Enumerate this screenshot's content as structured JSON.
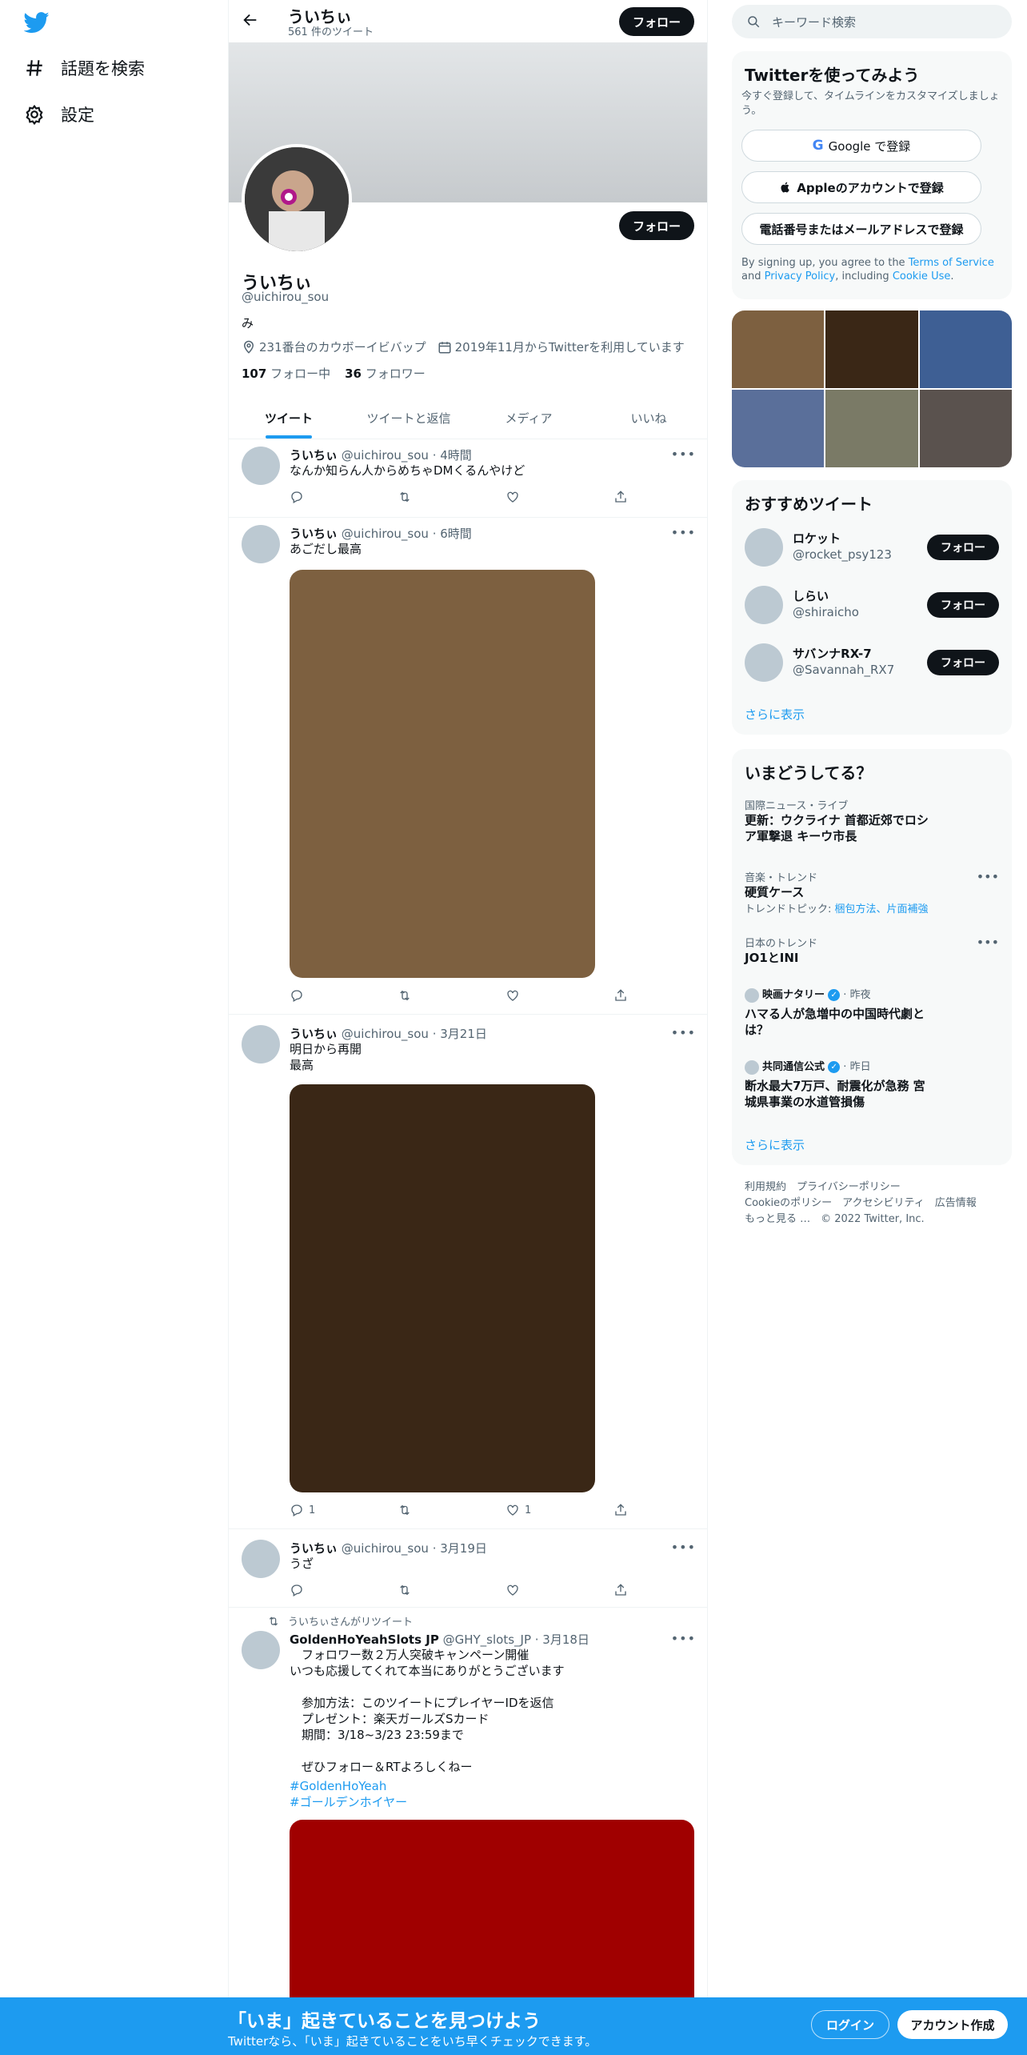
{
  "nav": {
    "items": [
      {
        "label": "話題を検索",
        "icon": "hashtag-icon"
      },
      {
        "label": "設定",
        "icon": "gear-icon"
      }
    ]
  },
  "header": {
    "name": "ういちぃ",
    "tweet_count": "561 件のツイート",
    "follow_label": "フォロー"
  },
  "profile": {
    "name": "ういちぃ",
    "handle": "@uichirou_sou",
    "bio": "み",
    "location": "231番台のカウボーイビバップ",
    "joined": "2019年11月からTwitterを利用しています",
    "following_count": "107",
    "following_label": "フォロー中",
    "followers_count": "36",
    "followers_label": "フォロワー",
    "follow_label": "フォロー"
  },
  "tabs": [
    {
      "label": "ツイート",
      "active": true
    },
    {
      "label": "ツイートと返信"
    },
    {
      "label": "メディア"
    },
    {
      "label": "いいね"
    }
  ],
  "tweets": [
    {
      "name": "ういちぃ",
      "handle": "@uichirou_sou",
      "time": "4時間",
      "text": "なんか知らん人からめちゃDMくるんやけど",
      "replies": "",
      "likes": ""
    },
    {
      "name": "ういちぃ",
      "handle": "@uichirou_sou",
      "time": "6時間",
      "text": "あごだし最高",
      "media_color": "#7d6040",
      "replies": "",
      "likes": ""
    },
    {
      "name": "ういちぃ",
      "handle": "@uichirou_sou",
      "time": "3月21日",
      "text": "明日から再開\n最高",
      "media_color": "#3a2716",
      "replies": "1",
      "likes": "1"
    },
    {
      "name": "ういちぃ",
      "handle": "@uichirou_sou",
      "time": "3月19日",
      "text": "うざ",
      "replies": "",
      "likes": ""
    },
    {
      "retweet_label": "ういちぃさんがリツイート",
      "name": "GoldenHoYeahSlots JP",
      "handle": "@GHY_slots_JP",
      "time": "3月18日",
      "text": "　フォロワー数２万人突破キャンペーン開催\nいつも応援してくれて本当にありがとうございます\n\n　参加方法：このツイートにプレイヤーIDを返信\n　プレゼント：楽天ガールズSカード\n　期間：3/18~3/23 23:59まで\n\n　ぜひフォロー＆RTよろしくねー",
      "hashtags": [
        "#GoldenHoYeah",
        "#ゴールデンホイヤー"
      ],
      "media_color": "#a00000"
    }
  ],
  "right": {
    "search_placeholder": "キーワード検索",
    "signup": {
      "title": "Twitterを使ってみよう",
      "subtitle": "今すぐ登録して、タイムラインをカスタマイズしましょう。",
      "google": "Google で登録",
      "apple": "Appleのアカウントで登録",
      "phone": "電話番号またはメールアドレスで登録",
      "terms_prefix": "By signing up, you agree to the ",
      "terms_link": "Terms of Service",
      "terms_and": " and ",
      "privacy_link": "Privacy Policy",
      "terms_mid": ", including ",
      "cookie_link": "Cookie Use",
      "terms_end": "."
    },
    "media_colors": [
      "#7d6040",
      "#3a2716",
      "#3e5f94",
      "#5a6f9a",
      "#7a7a66",
      "#5a524e"
    ],
    "who": {
      "title": "おすすめツイート",
      "users": [
        {
          "name": "ロケット",
          "handle": "@rocket_psy123",
          "button": "フォロー"
        },
        {
          "name": "しらい",
          "handle": "@shiraicho",
          "button": "フォロー"
        },
        {
          "name": "サバンナRX-7",
          "handle": "@Savannah_RX7",
          "button": "フォロー"
        }
      ],
      "more": "さらに表示"
    },
    "trends": {
      "title": "いまどうしてる？",
      "items": [
        {
          "category": "国際ニュース・ライブ",
          "title": "更新：ウクライナ 首都近郊でロシ\nア軍撃退 キーウ市長"
        },
        {
          "category": "音楽・トレンド",
          "title": "硬質ケース",
          "sub_prefix": "トレンドトピック: ",
          "sub_links": "梱包方法、片面補強"
        },
        {
          "category": "日本のトレンド",
          "title": "JO1とINI"
        },
        {
          "source": "映画ナタリー",
          "time": "昨夜",
          "title": "ハマる人が急増中の中国時代劇と\nは？"
        },
        {
          "source": "共同通信公式",
          "time": "昨日",
          "title": "断水最大7万戸、耐震化が急務 宮\n城県事業の水道管損傷"
        }
      ],
      "more": "さらに表示"
    },
    "footer": {
      "line1": "利用規約　プライバシーポリシー",
      "line2": "Cookieのポリシー　アクセシビリティ　広告情報",
      "line3": "もっと見る …　© 2022 Twitter, Inc."
    }
  },
  "bottombar": {
    "title": "「いま」起きていることを見つけよう",
    "subtitle": "Twitterなら、「いま」起きていることをいち早くチェックできます。",
    "login": "ログイン",
    "signup": "アカウント作成"
  },
  "colors": {
    "accent": "#1d9bf0",
    "text": "#0f1419",
    "muted": "#536471"
  }
}
